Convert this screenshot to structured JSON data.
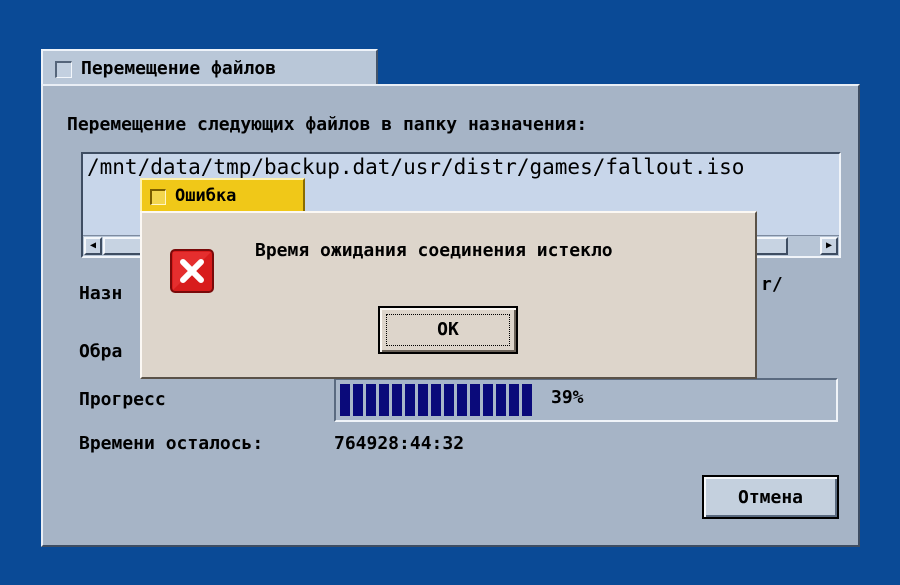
{
  "main_window": {
    "title": "Перемещение файлов",
    "header_label": "Перемещение следующих файлов в папку назначения:",
    "file_list": [
      "/mnt/data/tmp/backup.dat/usr/distr/games/fallout.iso"
    ],
    "destination_label": "Назн",
    "destination_value_tail": "r/",
    "processing_label": "Обра",
    "progress_label": "Прогресс",
    "progress_percent": 39,
    "progress_text": "39%",
    "time_remaining_label": "Времени осталось:",
    "time_remaining_value": "764928:44:32",
    "cancel_button": "Отмена",
    "scroll_left_glyph": "◀",
    "scroll_right_glyph": "▶"
  },
  "error_dialog": {
    "title": "Ошибка",
    "icon": "error-x-icon",
    "message": "Время ожидания соединения истекло",
    "ok_button": "OK"
  },
  "colors": {
    "desktop": "#0a4a96",
    "window_bg": "#a6b4c6",
    "list_bg": "#c8d6ea",
    "progress_fill": "#0a0a7a",
    "error_title_bg": "#f0c818",
    "error_bg": "#ddd5cb",
    "error_icon": "#d81c1c"
  }
}
